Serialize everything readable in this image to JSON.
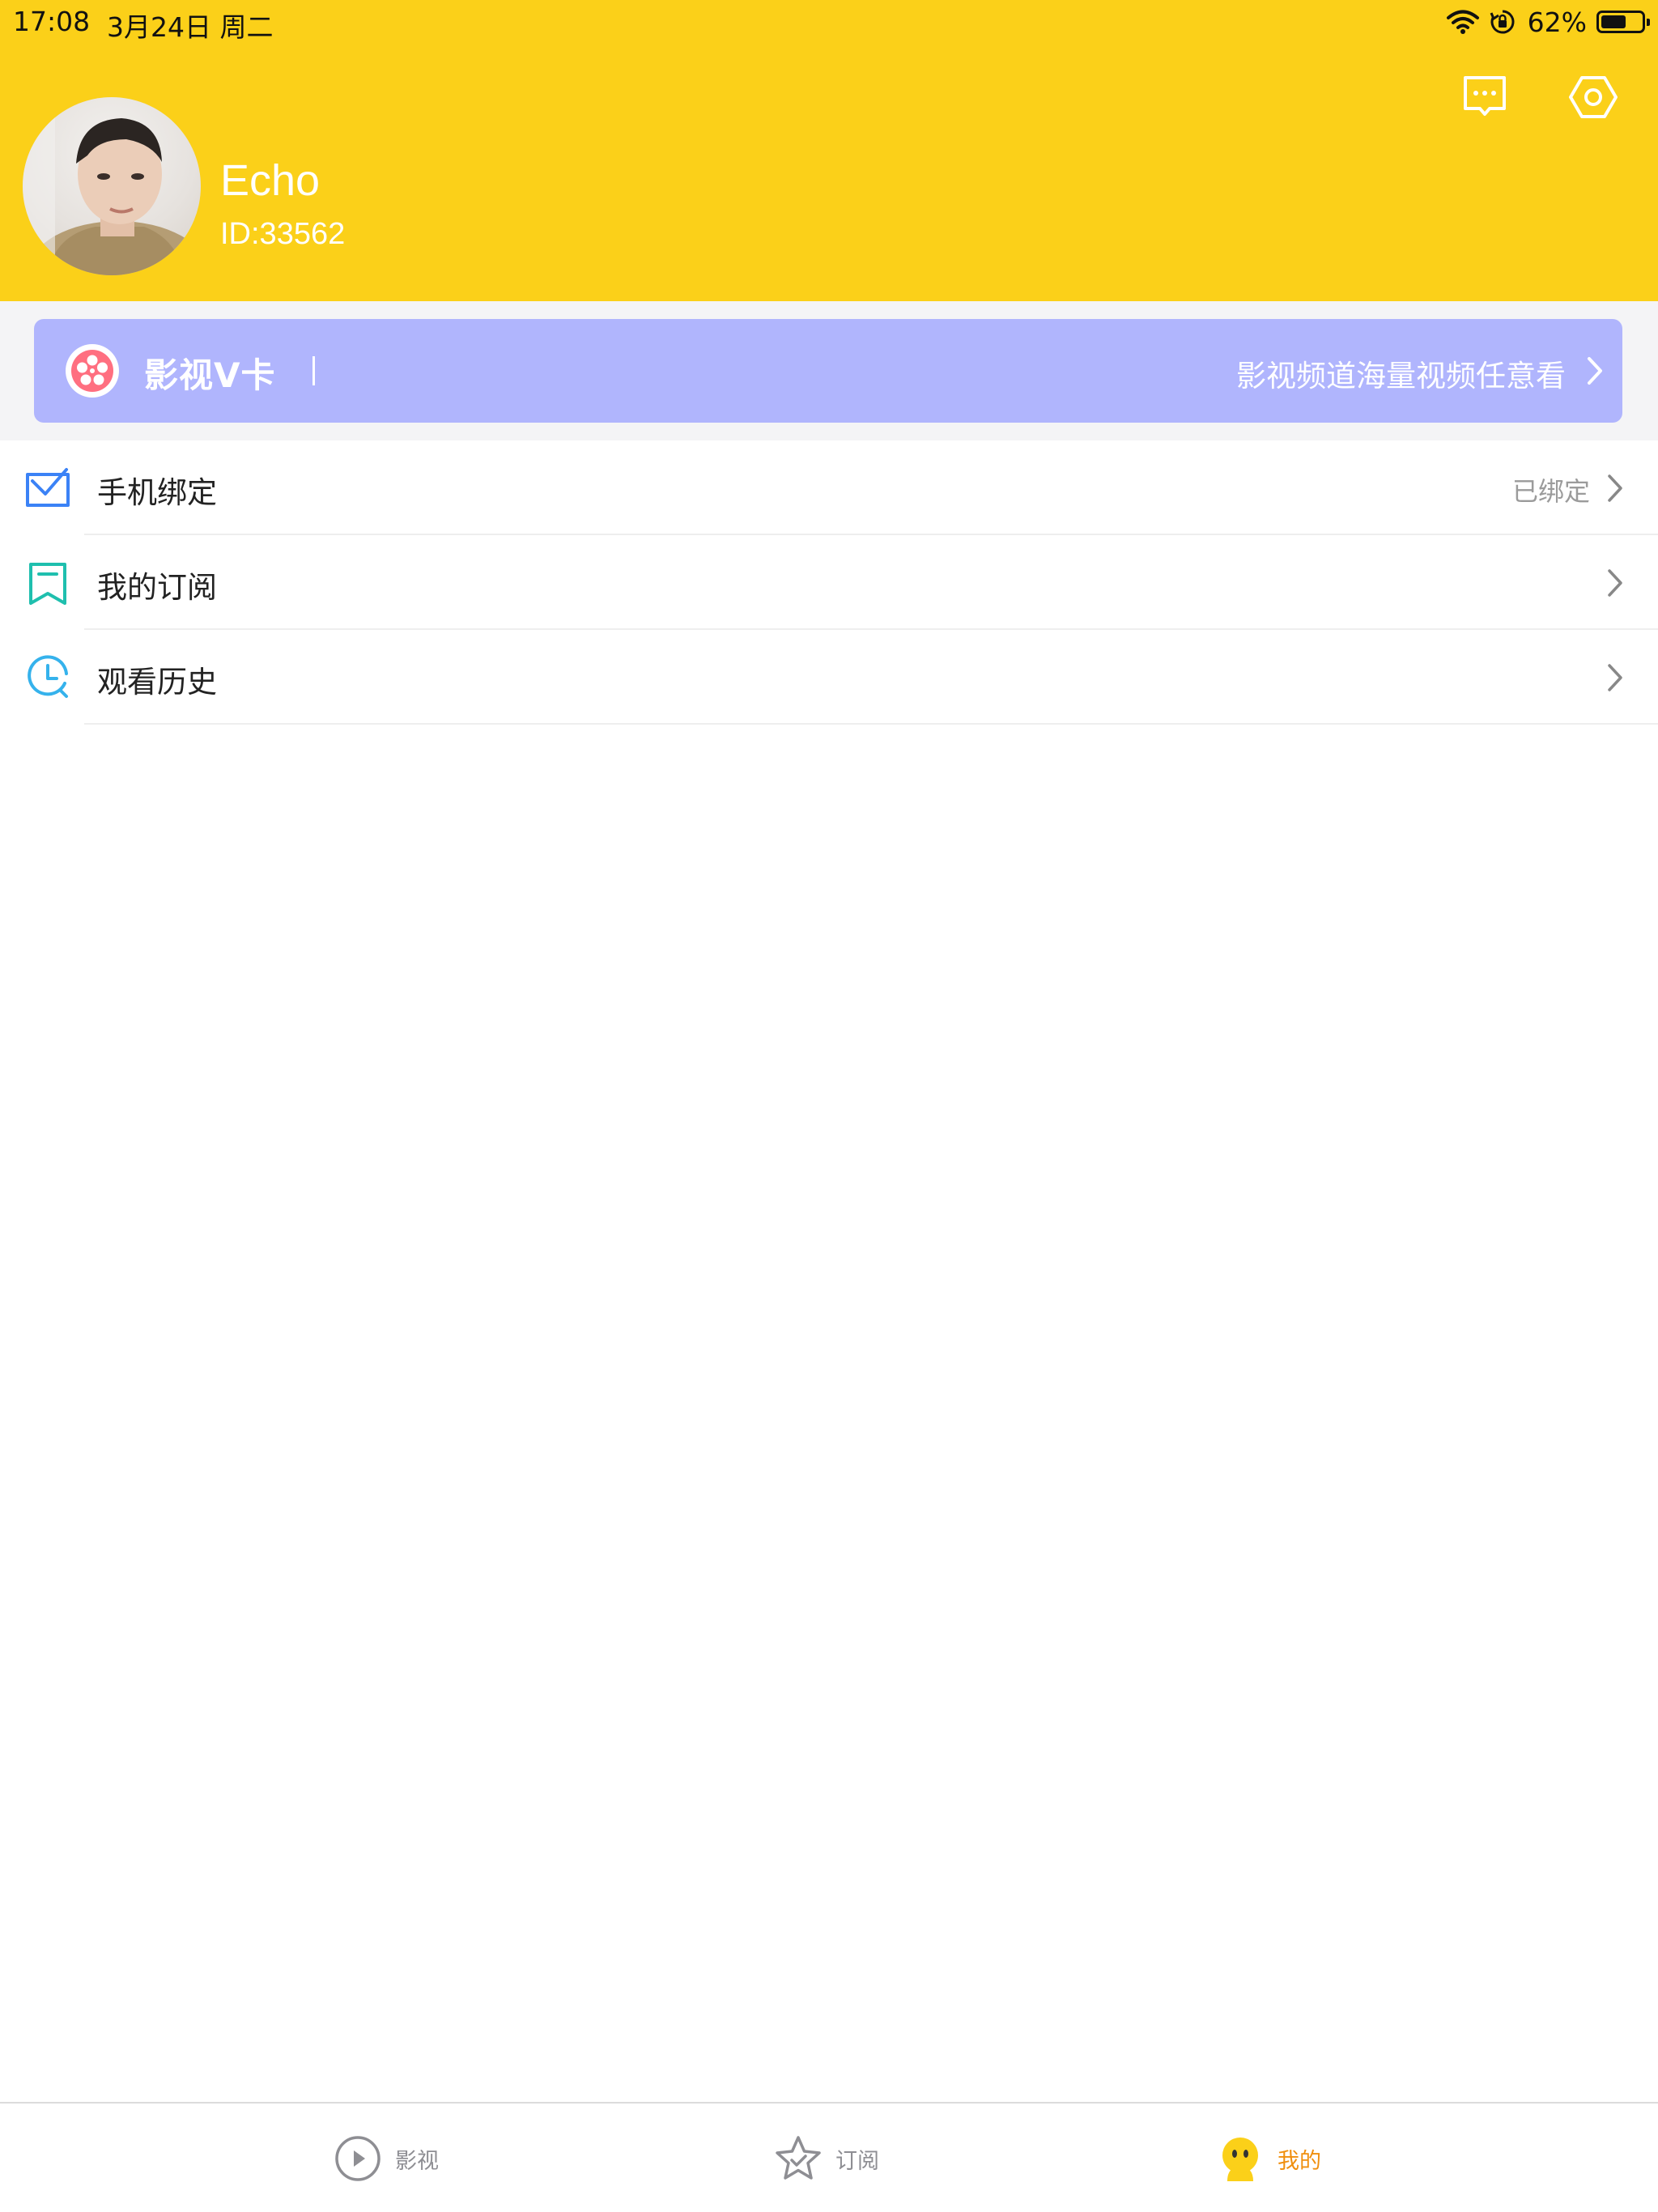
{
  "status_bar": {
    "time": "17:08",
    "date": "3月24日 周二",
    "battery_percent": "62%",
    "battery_level": 0.62
  },
  "profile": {
    "name": "Echo",
    "id": "ID:33562"
  },
  "vcard": {
    "title": "影视V卡",
    "description": "影视频道海量视频任意看"
  },
  "menu": {
    "items": [
      {
        "label": "手机绑定",
        "value": "已绑定",
        "icon": "mail-check-icon"
      },
      {
        "label": "我的订阅",
        "value": "",
        "icon": "bookmark-icon"
      },
      {
        "label": "观看历史",
        "value": "",
        "icon": "history-clock-icon"
      }
    ]
  },
  "tabbar": {
    "tabs": [
      {
        "label": "影视",
        "icon": "play-circle-icon",
        "active": false
      },
      {
        "label": "订阅",
        "icon": "star-check-icon",
        "active": false
      },
      {
        "label": "我的",
        "icon": "mascot-face-icon",
        "active": true
      }
    ]
  },
  "colors": {
    "header": "#FBD019",
    "vcard": "#B0B5FD",
    "active_tab": "#F08F0E",
    "inactive_tab": "#8E8E93"
  }
}
